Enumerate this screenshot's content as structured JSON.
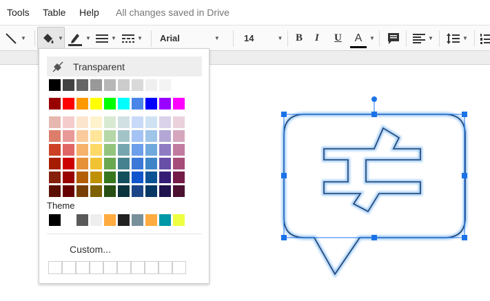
{
  "menu": {
    "tools": "Tools",
    "table": "Table",
    "help": "Help",
    "status": "All changes saved in Drive"
  },
  "toolbar": {
    "font": "Arial",
    "size": "14",
    "bold": "B",
    "italic": "I",
    "underline": "U",
    "text_color": "A"
  },
  "palette": {
    "transparent_label": "Transparent",
    "grays": [
      "#000000",
      "#434343",
      "#666666",
      "#999999",
      "#b7b7b7",
      "#cccccc",
      "#d9d9d9",
      "#efefef",
      "#f3f3f3",
      "#ffffff"
    ],
    "brights": [
      "#980000",
      "#ff0000",
      "#ff9900",
      "#ffff00",
      "#00ff00",
      "#00ffff",
      "#4a86e8",
      "#0000ff",
      "#9900ff",
      "#ff00ff"
    ],
    "shades": [
      [
        "#e6b8af",
        "#f4cccc",
        "#fce5cd",
        "#fff2cc",
        "#d9ead3",
        "#d0e0e3",
        "#c9daf8",
        "#cfe2f3",
        "#d9d2e9",
        "#ead1dc"
      ],
      [
        "#dd7e6b",
        "#ea9999",
        "#f9cb9c",
        "#ffe599",
        "#b6d7a8",
        "#a2c4c9",
        "#a4c2f4",
        "#9fc5e8",
        "#b4a7d6",
        "#d5a6bd"
      ],
      [
        "#cc4125",
        "#e06666",
        "#f6b26b",
        "#ffd966",
        "#93c47d",
        "#76a5af",
        "#6d9eeb",
        "#6fa8dc",
        "#8e7cc3",
        "#c27ba0"
      ],
      [
        "#a61c00",
        "#cc0000",
        "#e69138",
        "#f1c232",
        "#6aa84f",
        "#45818e",
        "#3c78d8",
        "#3d85c6",
        "#674ea7",
        "#a64d79"
      ],
      [
        "#85200c",
        "#990000",
        "#b45f06",
        "#bf9000",
        "#38761d",
        "#134f5c",
        "#1155cc",
        "#0b5394",
        "#351c75",
        "#741b47"
      ],
      [
        "#5b0f00",
        "#660000",
        "#783f04",
        "#7f6000",
        "#274e13",
        "#0c343d",
        "#1c4587",
        "#073763",
        "#20124d",
        "#4c1130"
      ]
    ],
    "theme_label": "Theme",
    "theme": [
      "#000000",
      "#ffffff",
      "#595959",
      "#eeeeee",
      "#ffab40",
      "#212121",
      "#78909c",
      "#ffab40",
      "#0097a7",
      "#eeff41"
    ],
    "custom_label": "Custom...",
    "colors": {
      "shape_stroke": "#1f3f6f",
      "selection": "#1a73e8",
      "glow": "#9ecbf5"
    }
  }
}
